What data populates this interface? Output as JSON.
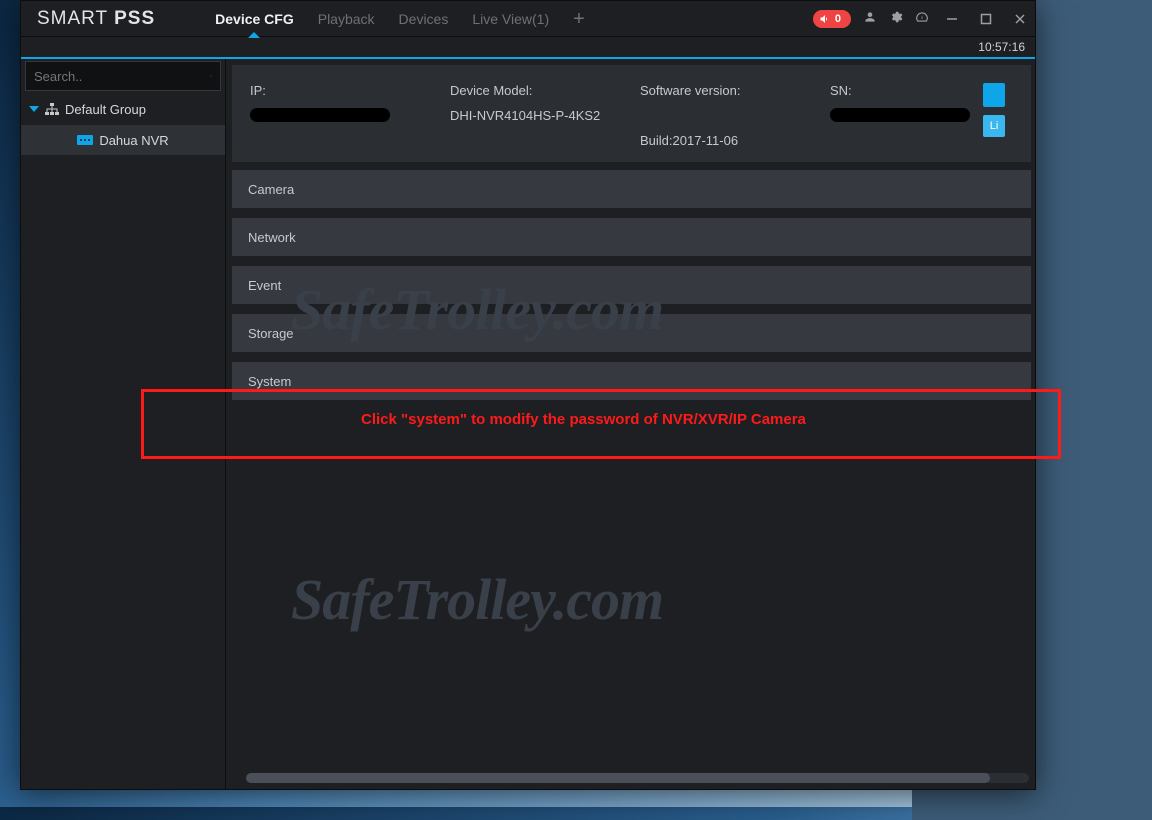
{
  "app": {
    "title_thin": "SMART",
    "title_bold": "PSS"
  },
  "tabs": {
    "items": [
      {
        "label": "Device CFG",
        "active": true
      },
      {
        "label": "Playback"
      },
      {
        "label": "Devices"
      },
      {
        "label": "Live View(1)"
      }
    ]
  },
  "alerts": {
    "count": "0"
  },
  "clock": "10:57:16",
  "sidebar": {
    "search_placeholder": "Search..",
    "group_label": "Default Group",
    "device_label": "Dahua NVR"
  },
  "info": {
    "ip_label": "IP:",
    "ip_value": "",
    "model_label": "Device Model:",
    "model_value": "DHI-NVR4104HS-P-4KS2",
    "sw_label": "Software version:",
    "build_label": "Build:2017-11-06",
    "sn_label": "SN:",
    "sn_value": "",
    "btn2_label": "Li"
  },
  "sections": {
    "items": [
      "Camera",
      "Network",
      "Event",
      "Storage",
      "System"
    ]
  },
  "callout": {
    "text": "Click \"system\" to modify the password of NVR/XVR/IP Camera"
  },
  "watermark": "SafeTrolley.com"
}
